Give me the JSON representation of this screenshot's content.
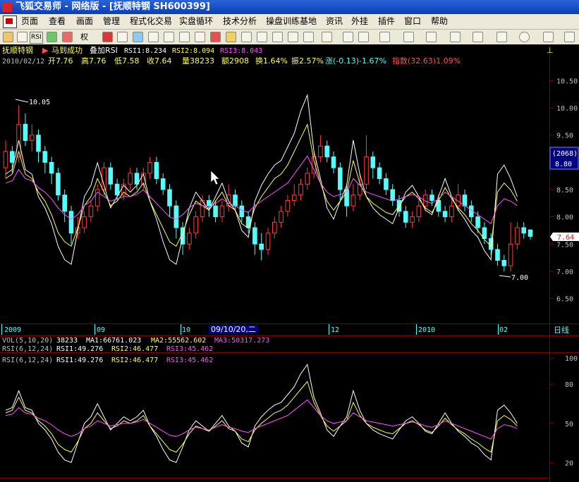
{
  "window": {
    "title": "飞狐交易师 - 网络版 - [抚顺特钢 SH600399]"
  },
  "menu": [
    "页面",
    "查看",
    "画面",
    "管理",
    "程式化交易",
    "实盘循环",
    "技术分析",
    "操盘训练基地",
    "资讯",
    "外挂",
    "插件",
    "窗口",
    "帮助"
  ],
  "toolbar": {
    "quan_label": "权",
    "rsi_label": "RSI"
  },
  "stock": {
    "name": "抚顺特钢",
    "code": "SH600399"
  },
  "header1": {
    "name": "抚顺特钢",
    "signal": "马到成功",
    "overlay": "叠加RSI",
    "rsi1": "RSI1:8.234",
    "rsi2": "RSI2:8.094",
    "rsi3": "RSI3:8.043"
  },
  "header2": {
    "date": "2010/02/12",
    "open": "开7.76",
    "high": "高7.76",
    "low": "低7.58",
    "close": "收7.64",
    "vol": "量38233",
    "amount": "额2908",
    "turnover": "换1.64%",
    "amplitude": "振2.57%",
    "change": "涨(-0.13)-1.67%",
    "index": "指数(32.63)1.09%"
  },
  "price_axis": [
    "10.50",
    "10.00",
    "9.50",
    "9.00",
    "8.50",
    "8.00",
    "7.50",
    "7.00",
    "6.50"
  ],
  "cursor_box": {
    "count": "(2068)",
    "price": "8.80"
  },
  "last_price": "7.64",
  "annotations": {
    "high": "10.05",
    "low": "7.00"
  },
  "time_axis": [
    "2009",
    "09",
    "10",
    "09/10/20,二",
    "12",
    "2010",
    "02"
  ],
  "period": "日线",
  "vol_header": {
    "label": "VOL(5,10,20)",
    "v": "38233",
    "ma1": "MA1:66761.023",
    "ma2": "MA2:55562.602",
    "ma3": "MA3:50317.273"
  },
  "rsi_header": {
    "label": "RSI(6,12,24)",
    "rsi1": "RSI1:49.276",
    "rsi2": "RSI2:46.477",
    "rsi3": "RSI3:45.462"
  },
  "rsi_axis": [
    "100",
    "80",
    "50",
    "20"
  ],
  "colors": {
    "up": "#ff3c3c",
    "down": "#54fcfc",
    "rsi1": "#ffffff",
    "rsi2": "#ffff54",
    "rsi3": "#ff54ff",
    "grid": "#800000"
  },
  "chart_data": {
    "type": "candlestick",
    "price_range": [
      6.3,
      10.7
    ],
    "rsi_range": [
      10,
      100
    ],
    "candles": [
      {
        "o": 8.9,
        "c": 9.2,
        "h": 9.4,
        "l": 8.7
      },
      {
        "o": 9.2,
        "c": 9.0,
        "h": 9.3,
        "l": 8.8
      },
      {
        "o": 9.1,
        "c": 9.7,
        "h": 10.05,
        "l": 9.0
      },
      {
        "o": 9.7,
        "c": 9.4,
        "h": 9.9,
        "l": 9.3
      },
      {
        "o": 9.4,
        "c": 9.5,
        "h": 9.7,
        "l": 9.2
      },
      {
        "o": 9.5,
        "c": 9.2,
        "h": 9.6,
        "l": 9.0
      },
      {
        "o": 9.2,
        "c": 9.0,
        "h": 9.3,
        "l": 8.8
      },
      {
        "o": 9.0,
        "c": 8.8,
        "h": 9.1,
        "l": 8.6
      },
      {
        "o": 8.8,
        "c": 8.4,
        "h": 8.9,
        "l": 8.3
      },
      {
        "o": 8.4,
        "c": 8.1,
        "h": 8.5,
        "l": 7.9
      },
      {
        "o": 8.1,
        "c": 7.7,
        "h": 8.2,
        "l": 7.5
      },
      {
        "o": 7.7,
        "c": 7.8,
        "h": 8.0,
        "l": 7.6
      },
      {
        "o": 7.8,
        "c": 8.0,
        "h": 8.1,
        "l": 7.7
      },
      {
        "o": 8.0,
        "c": 8.2,
        "h": 8.3,
        "l": 7.9
      },
      {
        "o": 8.2,
        "c": 8.5,
        "h": 8.6,
        "l": 8.1
      },
      {
        "o": 8.5,
        "c": 8.9,
        "h": 9.0,
        "l": 8.4
      },
      {
        "o": 8.9,
        "c": 8.6,
        "h": 9.0,
        "l": 8.5
      },
      {
        "o": 8.6,
        "c": 8.4,
        "h": 8.7,
        "l": 8.3
      },
      {
        "o": 8.4,
        "c": 8.6,
        "h": 8.7,
        "l": 8.3
      },
      {
        "o": 8.6,
        "c": 8.8,
        "h": 8.9,
        "l": 8.5
      },
      {
        "o": 8.8,
        "c": 8.6,
        "h": 8.9,
        "l": 8.5
      },
      {
        "o": 8.6,
        "c": 8.8,
        "h": 8.9,
        "l": 8.5
      },
      {
        "o": 8.8,
        "c": 9.0,
        "h": 9.1,
        "l": 8.7
      },
      {
        "o": 9.0,
        "c": 8.7,
        "h": 9.1,
        "l": 8.6
      },
      {
        "o": 8.7,
        "c": 8.5,
        "h": 8.8,
        "l": 8.4
      },
      {
        "o": 8.5,
        "c": 8.2,
        "h": 8.6,
        "l": 8.0
      },
      {
        "o": 8.2,
        "c": 7.8,
        "h": 8.3,
        "l": 7.6
      },
      {
        "o": 7.8,
        "c": 7.5,
        "h": 7.9,
        "l": 7.3
      },
      {
        "o": 7.5,
        "c": 7.7,
        "h": 7.8,
        "l": 7.4
      },
      {
        "o": 7.7,
        "c": 8.0,
        "h": 8.1,
        "l": 7.6
      },
      {
        "o": 8.0,
        "c": 8.3,
        "h": 8.4,
        "l": 7.9
      },
      {
        "o": 8.3,
        "c": 8.2,
        "h": 8.4,
        "l": 8.0
      },
      {
        "o": 8.2,
        "c": 8.0,
        "h": 8.3,
        "l": 7.9
      },
      {
        "o": 8.0,
        "c": 8.2,
        "h": 8.3,
        "l": 7.9
      },
      {
        "o": 8.2,
        "c": 8.4,
        "h": 8.6,
        "l": 8.1
      },
      {
        "o": 8.4,
        "c": 8.2,
        "h": 8.5,
        "l": 8.1
      },
      {
        "o": 8.2,
        "c": 8.0,
        "h": 8.3,
        "l": 7.9
      },
      {
        "o": 8.0,
        "c": 7.8,
        "h": 8.1,
        "l": 7.7
      },
      {
        "o": 7.8,
        "c": 7.5,
        "h": 7.9,
        "l": 7.3
      },
      {
        "o": 7.5,
        "c": 7.4,
        "h": 7.7,
        "l": 7.2
      },
      {
        "o": 7.4,
        "c": 7.7,
        "h": 7.8,
        "l": 7.3
      },
      {
        "o": 7.7,
        "c": 7.9,
        "h": 8.0,
        "l": 7.6
      },
      {
        "o": 7.9,
        "c": 8.1,
        "h": 8.2,
        "l": 7.8
      },
      {
        "o": 8.1,
        "c": 8.3,
        "h": 8.4,
        "l": 8.0
      },
      {
        "o": 8.3,
        "c": 8.4,
        "h": 8.6,
        "l": 8.2
      },
      {
        "o": 8.4,
        "c": 8.6,
        "h": 8.7,
        "l": 8.3
      },
      {
        "o": 8.6,
        "c": 8.8,
        "h": 8.9,
        "l": 8.5
      },
      {
        "o": 8.8,
        "c": 9.1,
        "h": 9.2,
        "l": 8.7
      },
      {
        "o": 9.1,
        "c": 9.3,
        "h": 9.5,
        "l": 9.0
      },
      {
        "o": 9.3,
        "c": 9.1,
        "h": 9.4,
        "l": 9.0
      },
      {
        "o": 9.1,
        "c": 8.9,
        "h": 9.2,
        "l": 8.8
      },
      {
        "o": 8.9,
        "c": 8.5,
        "h": 9.0,
        "l": 8.3
      },
      {
        "o": 8.5,
        "c": 8.2,
        "h": 8.6,
        "l": 8.0
      },
      {
        "o": 8.2,
        "c": 8.4,
        "h": 8.6,
        "l": 8.1
      },
      {
        "o": 8.4,
        "c": 8.6,
        "h": 8.8,
        "l": 8.3
      },
      {
        "o": 8.6,
        "c": 9.1,
        "h": 9.5,
        "l": 8.5
      },
      {
        "o": 9.1,
        "c": 8.9,
        "h": 9.2,
        "l": 8.7
      },
      {
        "o": 8.9,
        "c": 8.7,
        "h": 9.0,
        "l": 8.6
      },
      {
        "o": 8.7,
        "c": 8.5,
        "h": 8.8,
        "l": 8.4
      },
      {
        "o": 8.5,
        "c": 8.3,
        "h": 8.6,
        "l": 8.2
      },
      {
        "o": 8.3,
        "c": 8.1,
        "h": 8.4,
        "l": 8.0
      },
      {
        "o": 8.1,
        "c": 7.9,
        "h": 8.2,
        "l": 7.8
      },
      {
        "o": 7.9,
        "c": 8.0,
        "h": 8.1,
        "l": 7.8
      },
      {
        "o": 8.0,
        "c": 8.2,
        "h": 8.3,
        "l": 7.9
      },
      {
        "o": 8.2,
        "c": 8.4,
        "h": 8.5,
        "l": 8.1
      },
      {
        "o": 8.4,
        "c": 8.3,
        "h": 8.5,
        "l": 8.2
      },
      {
        "o": 8.3,
        "c": 8.1,
        "h": 8.4,
        "l": 8.0
      },
      {
        "o": 8.1,
        "c": 8.0,
        "h": 8.2,
        "l": 7.9
      },
      {
        "o": 8.0,
        "c": 8.2,
        "h": 8.3,
        "l": 7.9
      },
      {
        "o": 8.2,
        "c": 8.4,
        "h": 8.6,
        "l": 8.1
      },
      {
        "o": 8.4,
        "c": 8.2,
        "h": 8.5,
        "l": 8.1
      },
      {
        "o": 8.2,
        "c": 8.0,
        "h": 8.3,
        "l": 7.9
      },
      {
        "o": 8.0,
        "c": 7.8,
        "h": 8.1,
        "l": 7.7
      },
      {
        "o": 7.8,
        "c": 7.6,
        "h": 7.9,
        "l": 7.5
      },
      {
        "o": 7.6,
        "c": 7.4,
        "h": 7.7,
        "l": 7.3
      },
      {
        "o": 7.4,
        "c": 7.2,
        "h": 7.5,
        "l": 7.1
      },
      {
        "o": 7.2,
        "c": 7.1,
        "h": 7.3,
        "l": 7.0
      },
      {
        "o": 7.1,
        "c": 7.5,
        "h": 7.9,
        "l": 7.0
      },
      {
        "o": 7.5,
        "c": 7.8,
        "h": 7.9,
        "l": 7.4
      },
      {
        "o": 7.8,
        "c": 7.7,
        "h": 7.9,
        "l": 7.6
      },
      {
        "o": 7.76,
        "c": 7.64,
        "h": 7.76,
        "l": 7.58
      }
    ],
    "rsi1": [
      60,
      62,
      75,
      62,
      60,
      50,
      45,
      38,
      28,
      22,
      20,
      35,
      50,
      55,
      65,
      55,
      45,
      50,
      55,
      52,
      55,
      60,
      48,
      40,
      30,
      22,
      20,
      32,
      45,
      52,
      48,
      44,
      50,
      56,
      48,
      44,
      35,
      32,
      48,
      55,
      60,
      64,
      66,
      72,
      78,
      88,
      95,
      70,
      58,
      45,
      40,
      48,
      55,
      75,
      60,
      50,
      45,
      42,
      40,
      38,
      45,
      52,
      55,
      50,
      44,
      42,
      50,
      58,
      50,
      44,
      40,
      35,
      32,
      26,
      22,
      60,
      64,
      58,
      50
    ],
    "rsi2": [
      58,
      60,
      70,
      60,
      58,
      52,
      48,
      42,
      34,
      30,
      28,
      36,
      46,
      50,
      58,
      52,
      46,
      48,
      52,
      50,
      52,
      56,
      48,
      42,
      36,
      30,
      28,
      34,
      42,
      48,
      46,
      44,
      48,
      52,
      46,
      44,
      38,
      36,
      45,
      50,
      54,
      58,
      60,
      64,
      70,
      76,
      82,
      66,
      56,
      48,
      44,
      48,
      52,
      66,
      56,
      50,
      47,
      45,
      43,
      42,
      46,
      50,
      52,
      49,
      45,
      43,
      48,
      54,
      49,
      45,
      42,
      38,
      35,
      31,
      28,
      52,
      56,
      53,
      48
    ],
    "rsi3": [
      56,
      57,
      62,
      58,
      57,
      54,
      52,
      49,
      45,
      42,
      40,
      42,
      46,
      48,
      52,
      50,
      48,
      49,
      50,
      50,
      51,
      53,
      50,
      47,
      44,
      41,
      40,
      42,
      45,
      47,
      46,
      45,
      47,
      49,
      47,
      46,
      44,
      43,
      46,
      48,
      50,
      52,
      54,
      56,
      60,
      64,
      68,
      62,
      56,
      52,
      50,
      51,
      52,
      58,
      55,
      52,
      51,
      50,
      49,
      48,
      49,
      50,
      51,
      50,
      48,
      47,
      49,
      52,
      50,
      48,
      46,
      44,
      42,
      40,
      38,
      46,
      49,
      48,
      46
    ]
  }
}
